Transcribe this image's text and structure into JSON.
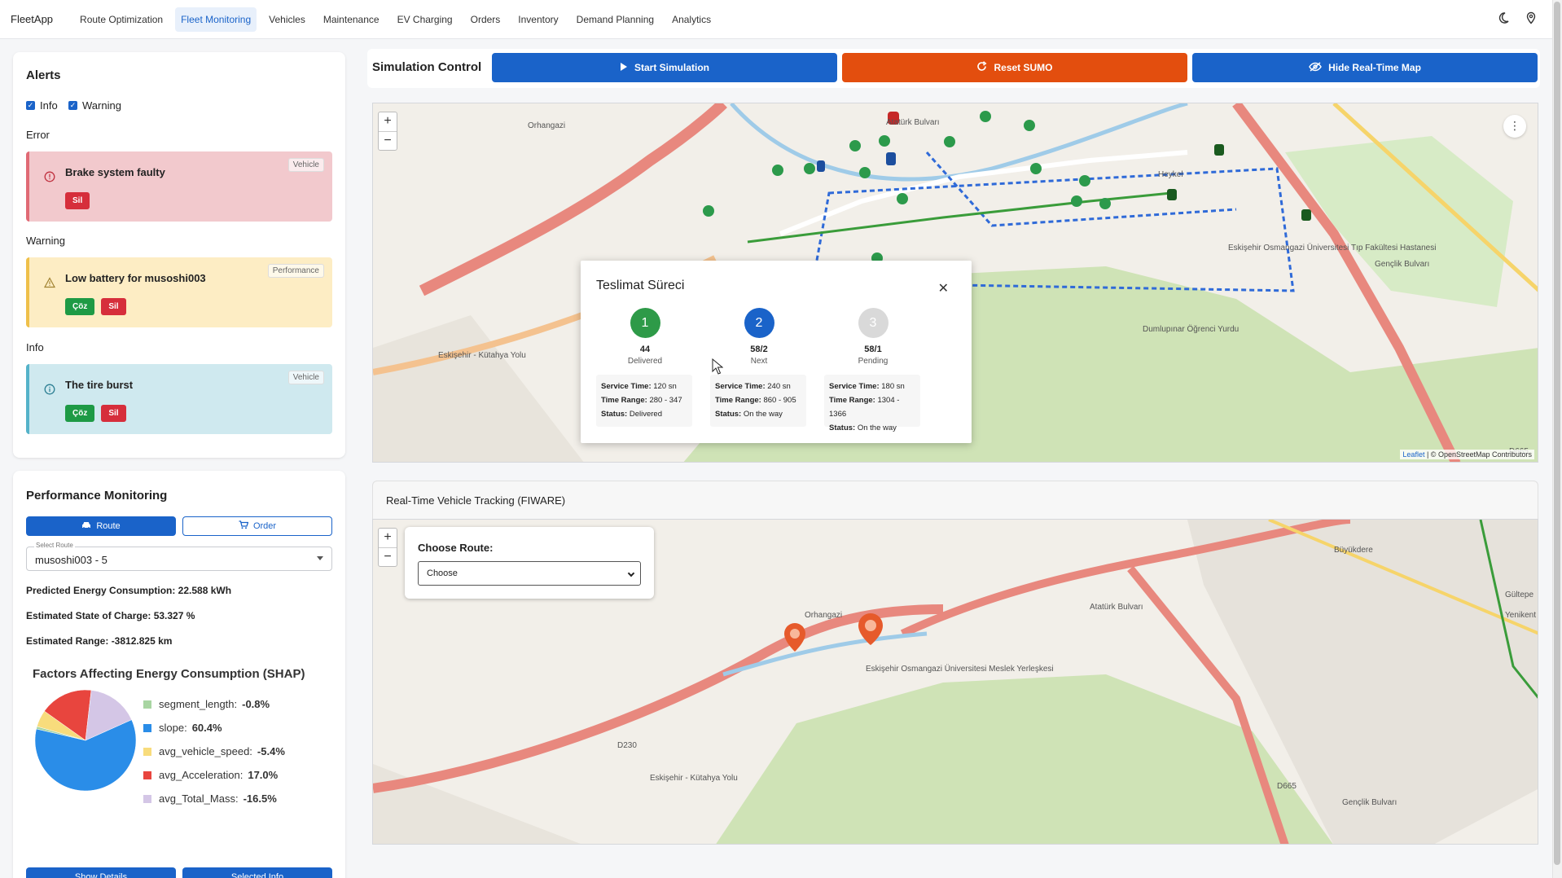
{
  "nav": {
    "brand": "FleetApp",
    "items": [
      "Route Optimization",
      "Fleet Monitoring",
      "Vehicles",
      "Maintenance",
      "EV Charging",
      "Orders",
      "Inventory",
      "Demand Planning",
      "Analytics"
    ],
    "active": "Fleet Monitoring"
  },
  "alerts": {
    "title": "Alerts",
    "filters": [
      {
        "label": "Info",
        "checked": true
      },
      {
        "label": "Warning",
        "checked": true
      }
    ],
    "groups": [
      {
        "label": "Error",
        "level": "error",
        "title": "Brake system faulty",
        "tag": "Vehicle",
        "buttons": [
          "Sil"
        ]
      },
      {
        "label": "Warning",
        "level": "warning",
        "title": "Low battery for musoshi003",
        "tag": "Performance",
        "buttons": [
          "Çöz",
          "Sil"
        ]
      },
      {
        "label": "Info",
        "level": "info",
        "title": "The tire burst",
        "tag": "Vehicle",
        "buttons": [
          "Çöz",
          "Sil"
        ]
      }
    ]
  },
  "performance": {
    "title": "Performance Monitoring",
    "tabs": [
      "Route",
      "Order"
    ],
    "select_legend": "Select Route",
    "select_value": "musoshi003 - 5",
    "metrics": [
      "Predicted Energy Consumption: 22.588 kWh",
      "Estimated State of Charge: 53.327 %",
      "Estimated Range: -3812.825 km"
    ],
    "bottom_buttons": [
      "Show Details",
      "Selected Info"
    ]
  },
  "chart_data": {
    "type": "pie",
    "title": "Factors Affecting Energy Consumption (SHAP)",
    "series": [
      {
        "name": "segment_length",
        "value": -0.8,
        "label": "-0.8%",
        "color": "#a8d5a2"
      },
      {
        "name": "slope",
        "value": 60.4,
        "label": "60.4%",
        "color": "#2a8de8"
      },
      {
        "name": "avg_vehicle_speed",
        "value": -5.4,
        "label": "-5.4%",
        "color": "#f8dc7c"
      },
      {
        "name": "avg_Acceleration",
        "value": 17.0,
        "label": "17.0%",
        "color": "#e8453e"
      },
      {
        "name": "avg_Total_Mass",
        "value": -16.5,
        "label": "-16.5%",
        "color": "#d4c6e6"
      }
    ],
    "legend_position": "right"
  },
  "simulation": {
    "title": "Simulation Control",
    "start_label": "Start Simulation",
    "reset_label": "Reset SUMO",
    "hide_label": "Hide Real-Time Map"
  },
  "popup": {
    "title": "Teslimat Süreci",
    "steps": [
      {
        "index": "1",
        "id": "44",
        "status_short": "Delivered",
        "color": "#2e9a48",
        "service": "120 sn",
        "range": "280 - 347",
        "status": "Delivered"
      },
      {
        "index": "2",
        "id": "58/2",
        "status_short": "Next",
        "color": "#1a63c9",
        "service": "240 sn",
        "range": "860 - 905",
        "status": "On the way"
      },
      {
        "index": "3",
        "id": "58/1",
        "status_short": "Pending",
        "color": "#d9d9d9",
        "service": "180 sn",
        "range": "1304 - 1366",
        "status": "On the way"
      }
    ],
    "service_label": "Service Time:",
    "range_label": "Time Range:",
    "status_label": "Status:"
  },
  "map1": {
    "labels": [
      "Orhangazi",
      "Dumlupınar Öğrenci Yurdu",
      "Eskişehir Osmangazi Üniversitesi Tıp Fakültesi Hastanesi",
      "D665",
      "Eskişehir - Kütahya Yolu",
      "Gençlik Bulvarı",
      "Atatürk Bulvarı",
      "Heykel"
    ],
    "attribution_link": "Leaflet",
    "attribution_text": "| © OpenStreetMap Contributors"
  },
  "tracking": {
    "title": "Real-Time Vehicle Tracking (FIWARE)",
    "choose_label": "Choose Route:",
    "choose_value": "Choose"
  },
  "map2": {
    "labels": [
      "Orhangazi",
      "Eskişehir Osmangazi Üniversitesi Meslek Yerleşkesi",
      "Büyükdere",
      "Yenikent",
      "Gültepe",
      "D665",
      "D230",
      "Eskişehir - Kütahya Yolu",
      "Gençlik Bulvarı",
      "Atatürk Bulvarı"
    ]
  }
}
